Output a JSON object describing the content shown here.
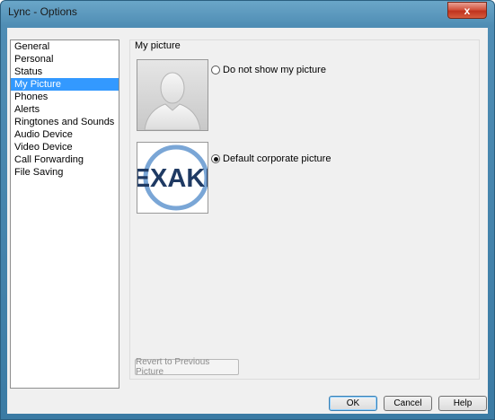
{
  "window": {
    "title": "Lync - Options",
    "close_glyph": "x"
  },
  "categories": [
    {
      "label": "General"
    },
    {
      "label": "Personal"
    },
    {
      "label": "Status"
    },
    {
      "label": "My Picture",
      "selected": true
    },
    {
      "label": "Phones"
    },
    {
      "label": "Alerts"
    },
    {
      "label": "Ringtones and Sounds"
    },
    {
      "label": "Audio Device"
    },
    {
      "label": "Video Device"
    },
    {
      "label": "Call Forwarding"
    },
    {
      "label": "File Saving"
    }
  ],
  "my_picture": {
    "section_title": "My picture",
    "options": [
      {
        "label": "Do not show my picture",
        "checked": false
      },
      {
        "label": "Default corporate picture",
        "checked": true
      }
    ],
    "corporate_logo_text": "EXAKI",
    "revert_label": "Revert to Previous Picture"
  },
  "footer": {
    "ok_label": "OK",
    "cancel_label": "Cancel",
    "help_label": "Help"
  },
  "colors": {
    "selection": "#3399ff",
    "title_bar": "#4f8db4",
    "close": "#c0331e",
    "logo_text": "#1f3a63",
    "logo_ring": "#7aa6d6"
  }
}
